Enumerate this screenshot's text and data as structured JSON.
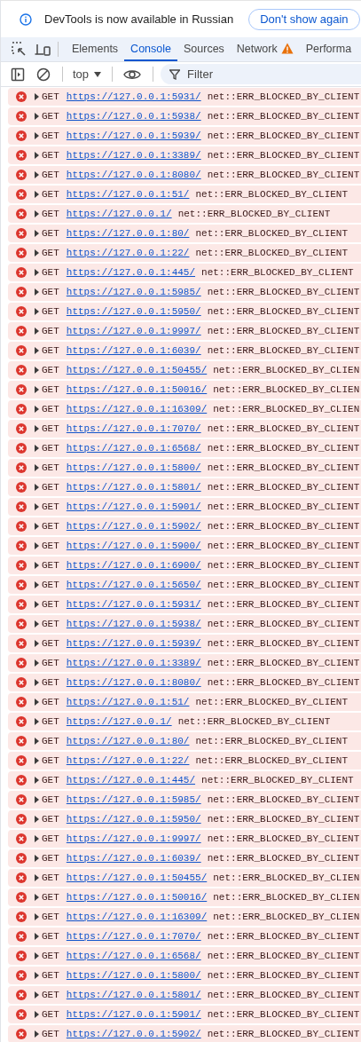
{
  "banner": {
    "message": "DevTools is now available in Russian",
    "button": "Don't show again"
  },
  "tabs": [
    {
      "label": "Elements",
      "selected": false,
      "warning": false
    },
    {
      "label": "Console",
      "selected": true,
      "warning": false
    },
    {
      "label": "Sources",
      "selected": false,
      "warning": false
    },
    {
      "label": "Network",
      "selected": false,
      "warning": true
    },
    {
      "label": "Performa",
      "selected": false,
      "warning": false
    }
  ],
  "toolbar": {
    "context": "top",
    "filter": {
      "placeholder": "Filter"
    }
  },
  "messages": [
    {
      "method": "GET",
      "url": "https://127.0.0.1:5931/",
      "text": "net::ERR_BLOCKED_BY_CLIENT"
    },
    {
      "method": "GET",
      "url": "https://127.0.0.1:5938/",
      "text": "net::ERR_BLOCKED_BY_CLIENT"
    },
    {
      "method": "GET",
      "url": "https://127.0.0.1:5939/",
      "text": "net::ERR_BLOCKED_BY_CLIENT"
    },
    {
      "method": "GET",
      "url": "https://127.0.0.1:3389/",
      "text": "net::ERR_BLOCKED_BY_CLIENT"
    },
    {
      "method": "GET",
      "url": "https://127.0.0.1:8080/",
      "text": "net::ERR_BLOCKED_BY_CLIENT"
    },
    {
      "method": "GET",
      "url": "https://127.0.0.1:51/",
      "text": "net::ERR_BLOCKED_BY_CLIENT"
    },
    {
      "method": "GET",
      "url": "https://127.0.0.1/",
      "text": "net::ERR_BLOCKED_BY_CLIENT"
    },
    {
      "method": "GET",
      "url": "https://127.0.0.1:80/",
      "text": "net::ERR_BLOCKED_BY_CLIENT"
    },
    {
      "method": "GET",
      "url": "https://127.0.0.1:22/",
      "text": "net::ERR_BLOCKED_BY_CLIENT"
    },
    {
      "method": "GET",
      "url": "https://127.0.0.1:445/",
      "text": "net::ERR_BLOCKED_BY_CLIENT"
    },
    {
      "method": "GET",
      "url": "https://127.0.0.1:5985/",
      "text": "net::ERR_BLOCKED_BY_CLIENT"
    },
    {
      "method": "GET",
      "url": "https://127.0.0.1:5950/",
      "text": "net::ERR_BLOCKED_BY_CLIENT"
    },
    {
      "method": "GET",
      "url": "https://127.0.0.1:9997/",
      "text": "net::ERR_BLOCKED_BY_CLIENT"
    },
    {
      "method": "GET",
      "url": "https://127.0.0.1:6039/",
      "text": "net::ERR_BLOCKED_BY_CLIENT"
    },
    {
      "method": "GET",
      "url": "https://127.0.0.1:50455/",
      "text": "net::ERR_BLOCKED_BY_CLIEN"
    },
    {
      "method": "GET",
      "url": "https://127.0.0.1:50016/",
      "text": "net::ERR_BLOCKED_BY_CLIEN"
    },
    {
      "method": "GET",
      "url": "https://127.0.0.1:16309/",
      "text": "net::ERR_BLOCKED_BY_CLIEN"
    },
    {
      "method": "GET",
      "url": "https://127.0.0.1:7070/",
      "text": "net::ERR_BLOCKED_BY_CLIENT"
    },
    {
      "method": "GET",
      "url": "https://127.0.0.1:6568/",
      "text": "net::ERR_BLOCKED_BY_CLIENT"
    },
    {
      "method": "GET",
      "url": "https://127.0.0.1:5800/",
      "text": "net::ERR_BLOCKED_BY_CLIENT"
    },
    {
      "method": "GET",
      "url": "https://127.0.0.1:5801/",
      "text": "net::ERR_BLOCKED_BY_CLIENT"
    },
    {
      "method": "GET",
      "url": "https://127.0.0.1:5901/",
      "text": "net::ERR_BLOCKED_BY_CLIENT"
    },
    {
      "method": "GET",
      "url": "https://127.0.0.1:5902/",
      "text": "net::ERR_BLOCKED_BY_CLIENT"
    },
    {
      "method": "GET",
      "url": "https://127.0.0.1:5900/",
      "text": "net::ERR_BLOCKED_BY_CLIENT"
    },
    {
      "method": "GET",
      "url": "https://127.0.0.1:6900/",
      "text": "net::ERR_BLOCKED_BY_CLIENT"
    },
    {
      "method": "GET",
      "url": "https://127.0.0.1:5650/",
      "text": "net::ERR_BLOCKED_BY_CLIENT"
    },
    {
      "method": "GET",
      "url": "https://127.0.0.1:5931/",
      "text": "net::ERR_BLOCKED_BY_CLIENT"
    },
    {
      "method": "GET",
      "url": "https://127.0.0.1:5938/",
      "text": "net::ERR_BLOCKED_BY_CLIENT"
    },
    {
      "method": "GET",
      "url": "https://127.0.0.1:5939/",
      "text": "net::ERR_BLOCKED_BY_CLIENT"
    },
    {
      "method": "GET",
      "url": "https://127.0.0.1:3389/",
      "text": "net::ERR_BLOCKED_BY_CLIENT"
    },
    {
      "method": "GET",
      "url": "https://127.0.0.1:8080/",
      "text": "net::ERR_BLOCKED_BY_CLIENT"
    },
    {
      "method": "GET",
      "url": "https://127.0.0.1:51/",
      "text": "net::ERR_BLOCKED_BY_CLIENT"
    },
    {
      "method": "GET",
      "url": "https://127.0.0.1/",
      "text": "net::ERR_BLOCKED_BY_CLIENT"
    },
    {
      "method": "GET",
      "url": "https://127.0.0.1:80/",
      "text": "net::ERR_BLOCKED_BY_CLIENT"
    },
    {
      "method": "GET",
      "url": "https://127.0.0.1:22/",
      "text": "net::ERR_BLOCKED_BY_CLIENT"
    },
    {
      "method": "GET",
      "url": "https://127.0.0.1:445/",
      "text": "net::ERR_BLOCKED_BY_CLIENT"
    },
    {
      "method": "GET",
      "url": "https://127.0.0.1:5985/",
      "text": "net::ERR_BLOCKED_BY_CLIENT"
    },
    {
      "method": "GET",
      "url": "https://127.0.0.1:5950/",
      "text": "net::ERR_BLOCKED_BY_CLIENT"
    },
    {
      "method": "GET",
      "url": "https://127.0.0.1:9997/",
      "text": "net::ERR_BLOCKED_BY_CLIENT"
    },
    {
      "method": "GET",
      "url": "https://127.0.0.1:6039/",
      "text": "net::ERR_BLOCKED_BY_CLIENT"
    },
    {
      "method": "GET",
      "url": "https://127.0.0.1:50455/",
      "text": "net::ERR_BLOCKED_BY_CLIEN"
    },
    {
      "method": "GET",
      "url": "https://127.0.0.1:50016/",
      "text": "net::ERR_BLOCKED_BY_CLIEN"
    },
    {
      "method": "GET",
      "url": "https://127.0.0.1:16309/",
      "text": "net::ERR_BLOCKED_BY_CLIEN"
    },
    {
      "method": "GET",
      "url": "https://127.0.0.1:7070/",
      "text": "net::ERR_BLOCKED_BY_CLIENT"
    },
    {
      "method": "GET",
      "url": "https://127.0.0.1:6568/",
      "text": "net::ERR_BLOCKED_BY_CLIENT"
    },
    {
      "method": "GET",
      "url": "https://127.0.0.1:5800/",
      "text": "net::ERR_BLOCKED_BY_CLIENT"
    },
    {
      "method": "GET",
      "url": "https://127.0.0.1:5801/",
      "text": "net::ERR_BLOCKED_BY_CLIENT"
    },
    {
      "method": "GET",
      "url": "https://127.0.0.1:5901/",
      "text": "net::ERR_BLOCKED_BY_CLIENT"
    },
    {
      "method": "GET",
      "url": "https://127.0.0.1:5902/",
      "text": "net::ERR_BLOCKED_BY_CLIENT"
    }
  ]
}
